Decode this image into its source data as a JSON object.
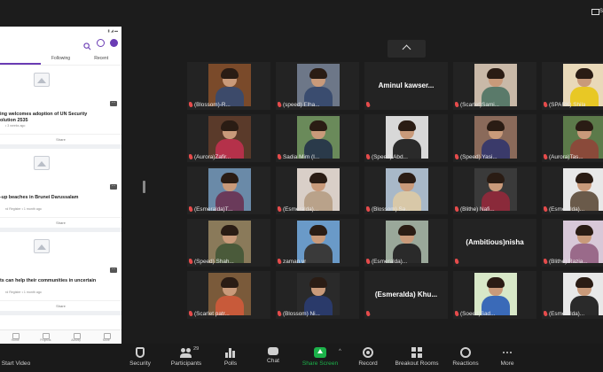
{
  "window": {
    "top_right_label": "S"
  },
  "phone": {
    "tabs": [
      "",
      "Following",
      "Recent"
    ],
    "cards": [
      {
        "title": "ing welcomes adoption of UN Security\nolution 2535",
        "meta": "• 3 weeks ago",
        "share": "Share"
      },
      {
        "title": "-up beaches in Brunei Darussalam",
        "meta": "rd Register  • 1 month ago",
        "share": "Share"
      },
      {
        "title": "ts can help their communities in uncertain",
        "meta": "rd Register  • 1 month ago",
        "share": "Share"
      }
    ],
    "nav": [
      "Home",
      "Projects",
      "Activity",
      "More"
    ]
  },
  "gallery": {
    "tiles": [
      {
        "name": "(Blossom)-R...",
        "video": true,
        "bg": "#7a4a2a",
        "shirt": "#3c4a6a"
      },
      {
        "name": "(speed)  Elha...",
        "video": true,
        "bg": "#6d7788",
        "shirt": "#3a4c6f"
      },
      {
        "name": "",
        "big": "Aminul  kawser...",
        "video": false
      },
      {
        "name": "(Scarlet)Sami...",
        "video": true,
        "bg": "#c9b9a8",
        "shirt": "#5a7a6a"
      },
      {
        "name": "(SPARK)  Shila",
        "video": true,
        "bg": "#e9d9b9",
        "shirt": "#e8c825"
      },
      {
        "name": "(Aurora)Zafir...",
        "video": true,
        "bg": "#5a3a2a",
        "shirt": "#b5314a"
      },
      {
        "name": "Sadia Mim (I...",
        "video": true,
        "bg": "#6a8a5a",
        "shirt": "#2a3a4a"
      },
      {
        "name": "(Speed) Abd...",
        "video": true,
        "bg": "#d8d8d8",
        "shirt": "#2a2a2a"
      },
      {
        "name": "(Speed)  Yasi...",
        "video": true,
        "bg": "#8a6a5a",
        "shirt": "#3a3a6a"
      },
      {
        "name": "(Aurora)Tas...",
        "video": true,
        "bg": "#5c7a4a",
        "shirt": "#8a4a3a"
      },
      {
        "name": "(Esmeralda)T...",
        "video": true,
        "bg": "#6a8aa8",
        "shirt": "#6a3a5a"
      },
      {
        "name": "(Esmeralda)...",
        "video": true,
        "bg": "#d9cfc8",
        "shirt": "#b9a28a"
      },
      {
        "name": "(Blossom)  Sa...",
        "video": true,
        "bg": "#a8b8c8",
        "shirt": "#d8c8a8"
      },
      {
        "name": "(Blithe)  Nafi...",
        "video": true,
        "bg": "#3a3a3a",
        "shirt": "#8a2a3a"
      },
      {
        "name": "(Esmeralda)...",
        "video": true,
        "bg": "#e8e8e8",
        "shirt": "#6a5a4a"
      },
      {
        "name": "(Speed)  Shah...",
        "video": true,
        "bg": "#8a7a5a",
        "shirt": "#4a5a3a"
      },
      {
        "name": "zaman vr",
        "video": true,
        "bg": "#6a9ac8",
        "shirt": "#3a3a3a"
      },
      {
        "name": "(Esmeralda)...",
        "video": true,
        "bg": "#9aa89a",
        "shirt": "#2a2a2a"
      },
      {
        "name": "",
        "big": "(Ambitious)nisha",
        "video": false
      },
      {
        "name": "(Blithe)  Razia...",
        "video": true,
        "bg": "#d8c8d8",
        "shirt": "#9a6a8a"
      },
      {
        "name": "(Scarlet  patr...",
        "video": true,
        "bg": "#7a5a3a",
        "shirt": "#c85a3a"
      },
      {
        "name": "(Blossom)  Ni...",
        "video": true,
        "bg": "#2a2a2a",
        "shirt": "#2a3a6a"
      },
      {
        "name": "",
        "big": "(Esmeralda)  Khu...",
        "video": false
      },
      {
        "name": "(Soeed)Sad...",
        "video": true,
        "bg": "#d8e8c8",
        "shirt": "#3a6ab8"
      },
      {
        "name": "(Esmeralda)...",
        "video": true,
        "bg": "#e8e8e8",
        "shirt": "#2a2a2a"
      }
    ]
  },
  "toolbar": {
    "start_video": "Start Video",
    "security": "Security",
    "participants": "Participants",
    "participant_count": "29",
    "polls": "Polls",
    "chat": "Chat",
    "share_screen": "Share Screen",
    "record": "Record",
    "breakout_rooms": "Breakout Rooms",
    "reactions": "Reactions",
    "more": "More"
  },
  "colors": {
    "accent_share": "#1cb24a",
    "mic_muted": "#e54b4b",
    "phone_accent": "#6a3cb4"
  }
}
